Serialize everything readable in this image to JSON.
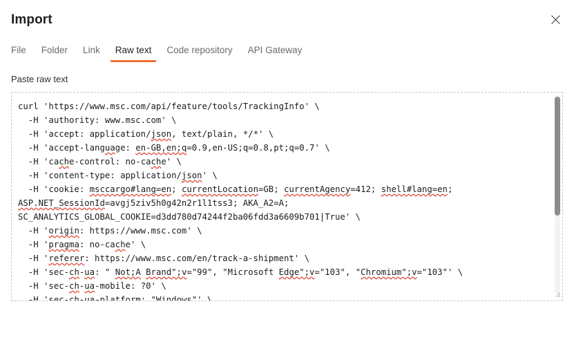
{
  "dialog": {
    "title": "Import",
    "close_icon": "close-icon"
  },
  "tabs": [
    {
      "label": "File",
      "active": false
    },
    {
      "label": "Folder",
      "active": false
    },
    {
      "label": "Link",
      "active": false
    },
    {
      "label": "Raw text",
      "active": true
    },
    {
      "label": "Code repository",
      "active": false
    },
    {
      "label": "API Gateway",
      "active": false
    }
  ],
  "form": {
    "label": "Paste raw text",
    "placeholder": "Paste raw text",
    "raw_text_lines": [
      "curl 'https://www.msc.com/api/feature/tools/TrackingInfo' \\",
      "  -H 'authority: www.msc.com' \\",
      "  -H 'accept: application/json, text/plain, */*' \\",
      "  -H 'accept-language: en-GB,en;q=0.9,en-US;q=0.8,pt;q=0.7' \\",
      "  -H 'cache-control: no-cache' \\",
      "  -H 'content-type: application/json' \\",
      "  -H 'cookie: msccargo#lang=en; currentLocation=GB; currentAgency=412; shell#lang=en;",
      "ASP.NET_SessionId=avgj5ziv5h0g42n2r1l1tss3; AKA_A2=A;",
      "SC_ANALYTICS_GLOBAL_COOKIE=d3dd780d74244f2ba06fdd3a6609b701|True' \\",
      "  -H 'origin: https://www.msc.com' \\",
      "  -H 'pragma: no-cache' \\",
      "  -H 'referer: https://www.msc.com/en/track-a-shipment' \\",
      "  -H 'sec-ch-ua: \" Not;A Brand\";v=\"99\", \"Microsoft Edge\";v=\"103\", \"Chromium\";v=\"103\"' \\",
      "  -H 'sec-ch-ua-mobile: ?0' \\",
      "  -H 'sec-ch-ua-platform: \"Windows\"' \\"
    ]
  },
  "colors": {
    "accent": "#ef6c35",
    "text": "#1f1f1f",
    "muted": "#6b6b6b",
    "border_dashed": "#c8c8c8",
    "scrollbar_thumb": "#8c8c8c",
    "spellcheck_underline": "#e04a3a"
  },
  "scrollbar": {
    "orientation": "vertical",
    "thumb_position_percent": 1,
    "thumb_size_percent": 60
  }
}
